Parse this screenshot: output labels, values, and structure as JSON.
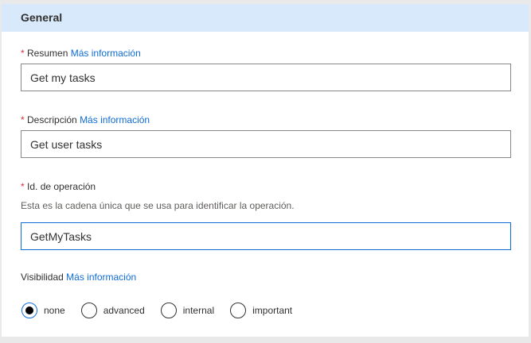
{
  "section": {
    "title": "General"
  },
  "fields": [
    {
      "label": "Resumen",
      "required": true,
      "link": "Más información",
      "value": "Get my tasks"
    },
    {
      "label": "Descripción",
      "required": true,
      "link": "Más información",
      "value": "Get user tasks"
    },
    {
      "label": "Id. de operación",
      "required": true,
      "help": "Esta es la cadena única que se usa para identificar la operación.",
      "value": "GetMyTasks"
    }
  ],
  "visibility": {
    "label": "Visibilidad",
    "link": "Más información",
    "options": [
      "none",
      "advanced",
      "internal",
      "important"
    ],
    "selected": "none"
  },
  "required_mark": "*"
}
